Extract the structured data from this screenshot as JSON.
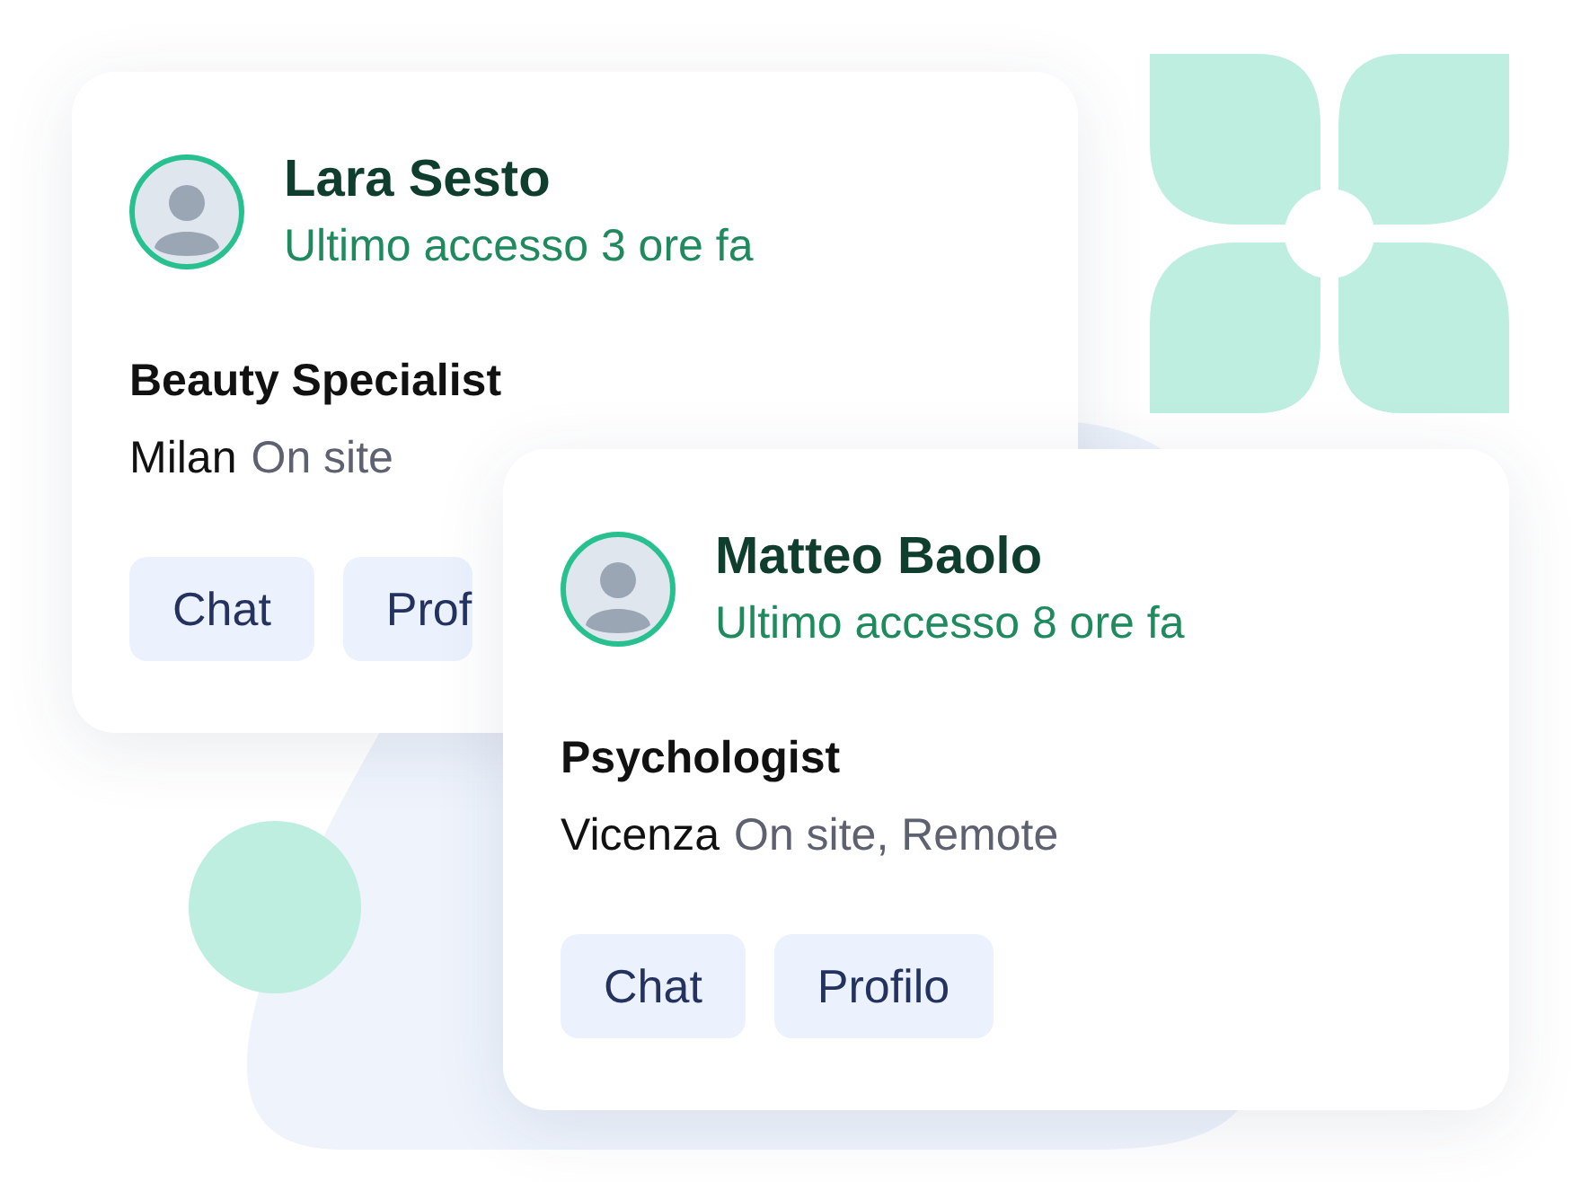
{
  "cards": [
    {
      "name": "Lara Sesto",
      "last_seen": "Ultimo accesso 3 ore fa",
      "role": "Beauty Specialist",
      "city": "Milan",
      "work_mode": "On site",
      "buttons": [
        "Chat",
        "Prof"
      ]
    },
    {
      "name": "Matteo Baolo",
      "last_seen": "Ultimo accesso 8 ore fa",
      "role": "Psychologist",
      "city": "Vicenza",
      "work_mode": "On site, Remote",
      "buttons": [
        "Chat",
        "Profilo"
      ]
    }
  ]
}
